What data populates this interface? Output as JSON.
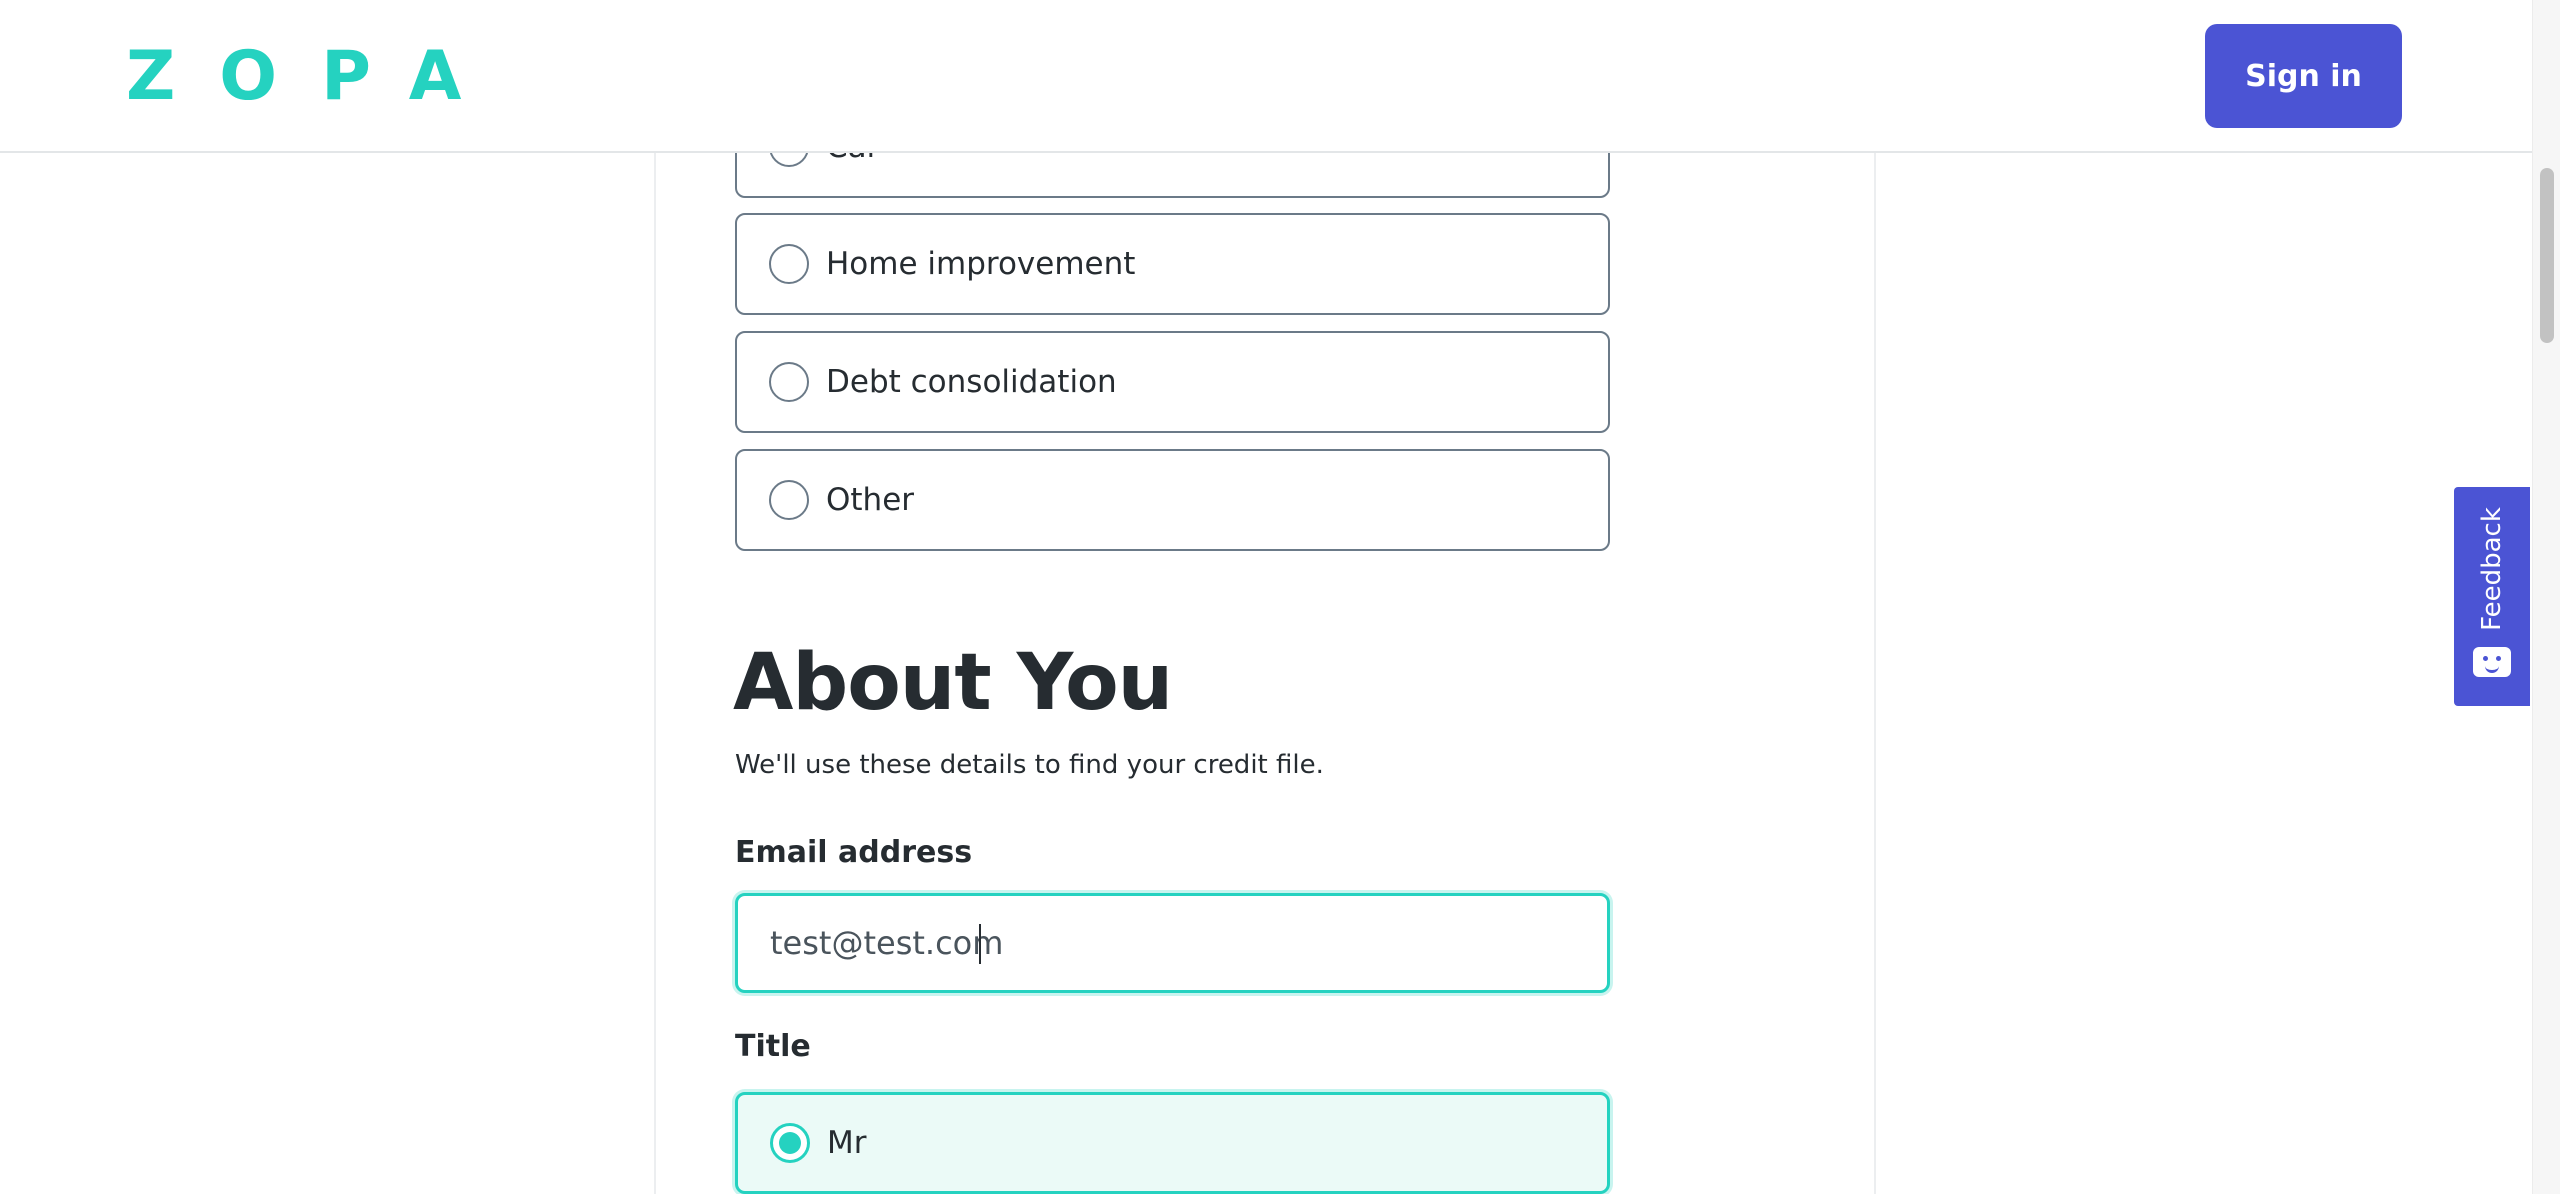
{
  "header": {
    "logo_text": "ZOPA",
    "signin_label": "Sign in"
  },
  "loan_purpose": {
    "options": [
      {
        "label": "Car",
        "selected": false
      },
      {
        "label": "Home improvement",
        "selected": false
      },
      {
        "label": "Debt consolidation",
        "selected": false
      },
      {
        "label": "Other",
        "selected": false
      }
    ]
  },
  "about_you": {
    "title": "About You",
    "subtitle": "We'll use these details to find your credit file.",
    "email_label": "Email address",
    "email_value": "test@test.com",
    "title_label": "Title",
    "title_options": [
      {
        "label": "Mr",
        "selected": true
      }
    ]
  },
  "feedback": {
    "label": "Feedback",
    "icon": "chat-face-icon"
  },
  "colors": {
    "brand_teal": "#25d2c0",
    "button_indigo": "#4b54d4",
    "text_dark": "#262c31"
  }
}
